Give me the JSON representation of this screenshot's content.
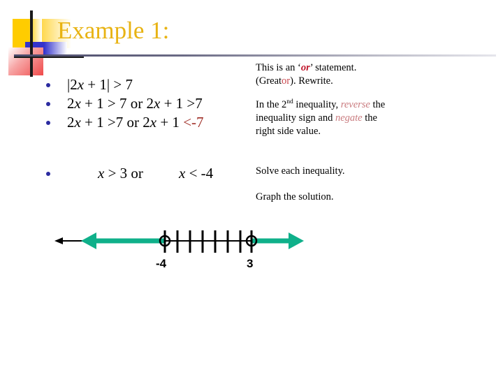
{
  "slide": {
    "title": "Example 1:",
    "title_color": "#E8B313"
  },
  "decoration": {
    "yellow_block": "yellow-square",
    "blue_block": "blue-bar",
    "red_block": "red-square",
    "vertical_bar": "black-vertical-bar",
    "horizontal_bar": "black-horizontal-bar"
  },
  "steps": [
    {
      "id": "step-1",
      "bullet": "bullet-dot",
      "parts": [
        {
          "text": "|2",
          "style": "plain"
        },
        {
          "text": "x",
          "style": "italic"
        },
        {
          "text": " + 1| > 7",
          "style": "plain"
        }
      ]
    },
    {
      "id": "step-2",
      "bullet": "bullet-dot",
      "parts": [
        {
          "text": "2",
          "style": "plain"
        },
        {
          "text": "x",
          "style": "italic"
        },
        {
          "text": " + 1 > 7 or 2",
          "style": "plain"
        },
        {
          "text": "x",
          "style": "italic"
        },
        {
          "text": " + 1 >7",
          "style": "plain"
        }
      ]
    },
    {
      "id": "step-3",
      "bullet": "bullet-dot",
      "parts": [
        {
          "text": "2",
          "style": "plain"
        },
        {
          "text": "x",
          "style": "italic"
        },
        {
          "text": " + 1 >7  or 2",
          "style": "plain"
        },
        {
          "text": "x",
          "style": "italic"
        },
        {
          "text": " + 1 ",
          "style": "plain"
        },
        {
          "text": "<-7",
          "style": "red"
        }
      ]
    }
  ],
  "solution": {
    "bullet": "bullet-dot",
    "left_parts": [
      {
        "text": "x",
        "style": "italic"
      },
      {
        "text": " > 3 or",
        "style": "plain"
      }
    ],
    "right_parts": [
      {
        "text": "x",
        "style": "italic"
      },
      {
        "text": " < -4",
        "style": "plain"
      }
    ],
    "left_text": "x > 3 or",
    "right_text": "x < -4"
  },
  "notes": [
    {
      "id": "note-or-statement",
      "lines": [
        [
          {
            "text": "This is an ‘",
            "style": "plain"
          },
          {
            "text": "or",
            "style": "or-em"
          },
          {
            "text": "’  statement.",
            "style": "plain"
          }
        ],
        [
          {
            "text": "(Great",
            "style": "plain"
          },
          {
            "text": "or",
            "style": "or-red"
          },
          {
            "text": ").  Rewrite.",
            "style": "plain"
          }
        ]
      ]
    },
    {
      "id": "note-reverse-negate",
      "lines": [
        [
          {
            "text": "In the 2",
            "style": "plain"
          },
          {
            "text": "nd",
            "style": "sup"
          },
          {
            "text": " inequality, ",
            "style": "plain"
          },
          {
            "text": "reverse",
            "style": "soft-red"
          },
          {
            "text": " the",
            "style": "plain"
          }
        ],
        [
          {
            "text": "inequality sign and ",
            "style": "plain"
          },
          {
            "text": "negate",
            "style": "soft-red"
          },
          {
            "text": " the",
            "style": "plain"
          }
        ],
        [
          {
            "text": "right side value.",
            "style": "plain"
          }
        ]
      ]
    }
  ],
  "note_solve": "Solve each inequality.",
  "note_graph": "Graph the solution.",
  "number_line": {
    "labels": {
      "left": "-4",
      "right": "3"
    },
    "open_circles": [
      -4,
      3
    ],
    "tick_count": 6,
    "highlight_color": "#0FB08A",
    "axis_color": "#000000",
    "left_ray_direction": "left",
    "right_ray_direction": "right"
  }
}
